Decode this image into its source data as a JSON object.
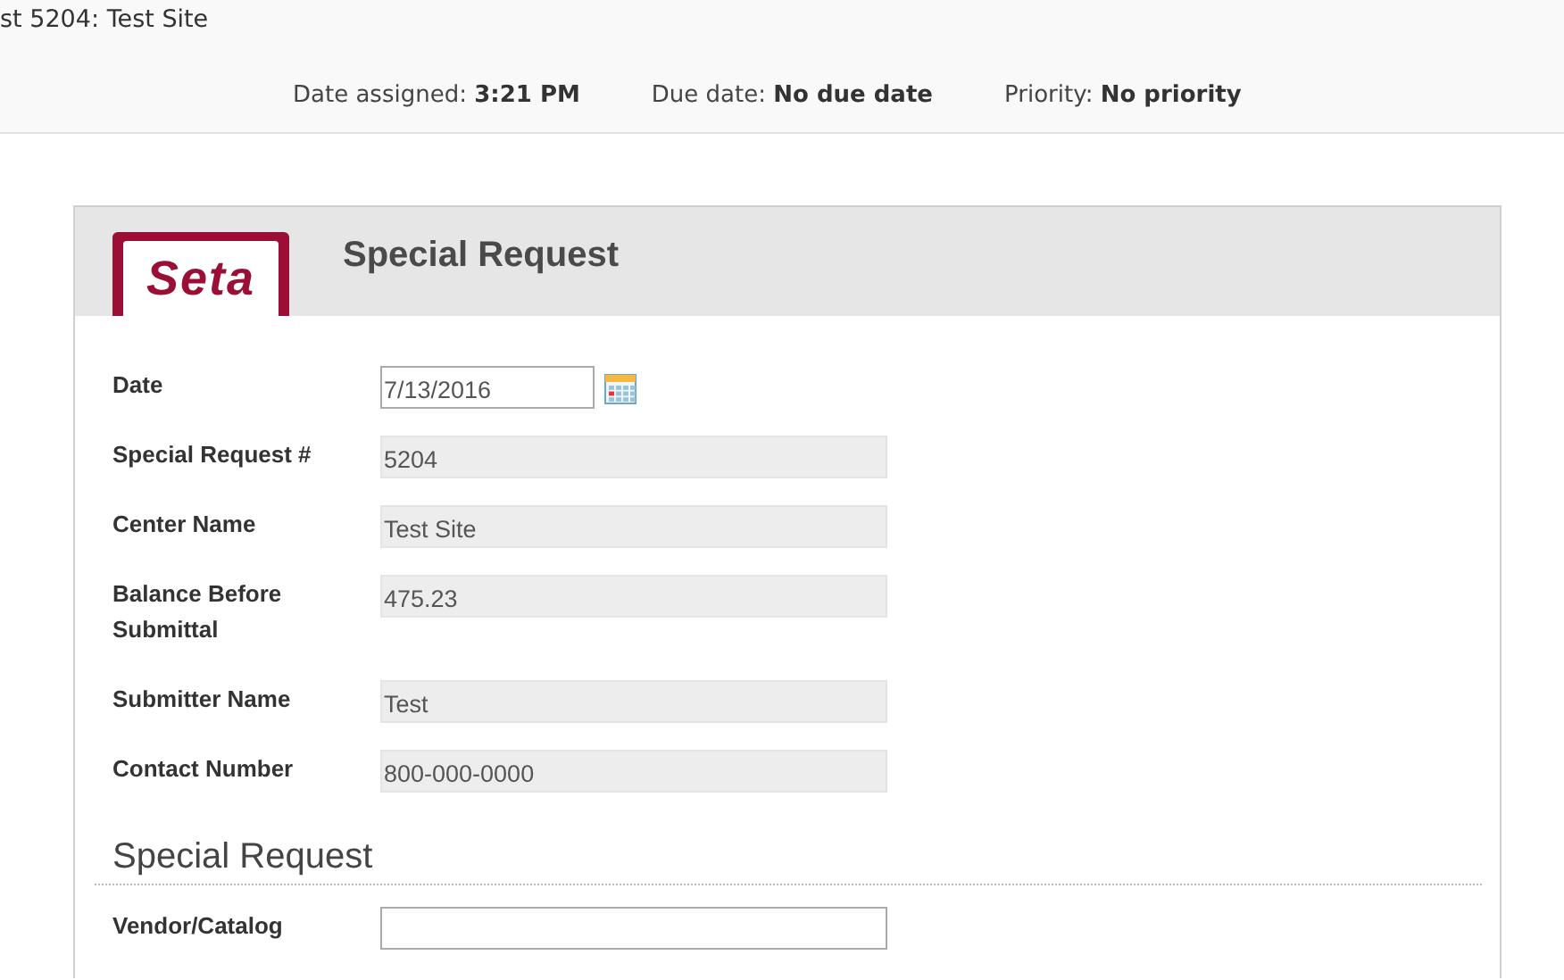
{
  "page_title": "st 5204: Test Site",
  "meta": [
    {
      "label": "Date assigned:",
      "value": "3:21 PM"
    },
    {
      "label": "Due date:",
      "value": "No due date"
    },
    {
      "label": "Priority:",
      "value": "No priority"
    }
  ],
  "form": {
    "logo": "Seta",
    "title": "Special Request",
    "fields": [
      {
        "kind": "date",
        "label": "Date",
        "value": "7/13/2016"
      },
      {
        "kind": "readonly",
        "label": "Special Request #",
        "value": "5204"
      },
      {
        "kind": "readonly",
        "label": "Center Name",
        "value": "Test Site"
      },
      {
        "kind": "readonly",
        "label": "Balance Before Submittal",
        "value": "475.23"
      },
      {
        "kind": "readonly",
        "label": "Submitter Name",
        "value": "Test"
      },
      {
        "kind": "readonly",
        "label": "Contact Number",
        "value": "800-000-0000"
      }
    ],
    "section": {
      "heading": "Special Request",
      "fields": [
        {
          "kind": "text",
          "label": "Vendor/Catalog"
        }
      ]
    }
  }
}
